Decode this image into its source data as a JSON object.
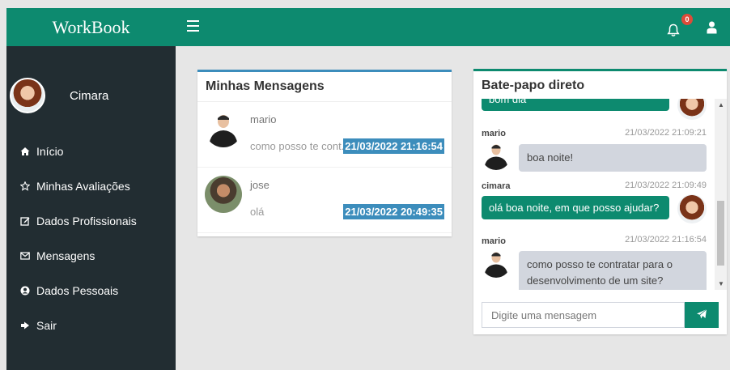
{
  "app": {
    "brand": "WorkBook"
  },
  "colors": {
    "primary": "#0d8a6f",
    "sidebar": "#222d32",
    "accent_blue": "#3c8dbc",
    "badge": "#dd4b39"
  },
  "header": {
    "notification_count": "0"
  },
  "sidebar": {
    "user_name": "Cimara",
    "items": [
      {
        "label": "Início",
        "icon": "home-icon"
      },
      {
        "label": "Minhas Avaliações",
        "icon": "star-icon"
      },
      {
        "label": "Dados Profissionais",
        "icon": "edit-icon"
      },
      {
        "label": "Mensagens",
        "icon": "envelope-icon"
      },
      {
        "label": "Dados Pessoais",
        "icon": "user-circle-icon"
      },
      {
        "label": "Sair",
        "icon": "sign-out-icon"
      }
    ]
  },
  "messages_panel": {
    "title": "Minhas Mensagens",
    "items": [
      {
        "sender": "mario",
        "preview": "como posso te cont...",
        "date": "21/03/2022 21:16:54"
      },
      {
        "sender": "jose",
        "preview": "olá",
        "date": "21/03/2022 20:49:35"
      }
    ]
  },
  "chat": {
    "title": "Bate-papo direto",
    "messages": [
      {
        "from": "cimara",
        "text": "bom dia"
      },
      {
        "from": "mario",
        "time": "21/03/2022 21:09:21",
        "text": "boa noite!"
      },
      {
        "from": "cimara",
        "time": "21/03/2022 21:09:49",
        "text": "olá boa noite, em que posso ajudar?"
      },
      {
        "from": "mario",
        "time": "21/03/2022 21:16:54",
        "text": "como posso te contratar para o desenvolvimento de um site?"
      }
    ],
    "input_placeholder": "Digite uma mensagem"
  }
}
